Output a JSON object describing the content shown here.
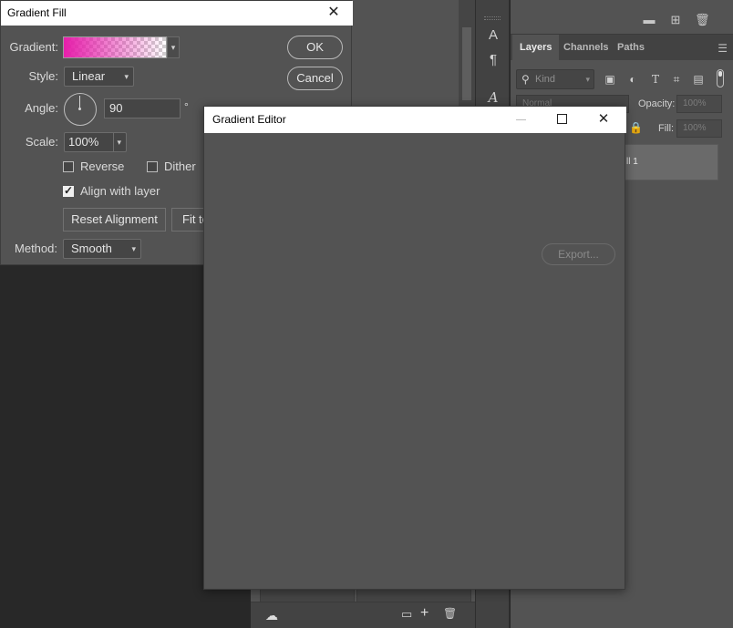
{
  "gradient_fill": {
    "title": "Gradient Fill",
    "labels": {
      "gradient": "Gradient:",
      "style": "Style:",
      "angle": "Angle:",
      "scale": "Scale:",
      "method": "Method:"
    },
    "style_value": "Linear",
    "angle_value": "90",
    "degree_symbol": "°",
    "scale_value": "100%",
    "method_value": "Smooth",
    "reverse_label": "Reverse",
    "reverse_checked": false,
    "dither_label": "Dither",
    "dither_checked": false,
    "align_label": "Align with layer",
    "align_checked": true,
    "reset_alignment_label": "Reset Alignment",
    "fit_label": "Fit to",
    "ok_label": "OK",
    "cancel_label": "Cancel",
    "gradient_color": "#e61eaa"
  },
  "gradient_editor": {
    "title": "Gradient Editor",
    "export_label": "Export..."
  },
  "layers_panel": {
    "tabs": [
      "Layers",
      "Channels",
      "Paths"
    ],
    "active_tab": "Layers",
    "kind_placeholder": "Kind",
    "blend_mode": "Normal",
    "opacity_label": "Opacity:",
    "opacity_value": "100%",
    "fill_label": "Fill:",
    "fill_value": "100%",
    "layer_name": "ll 1"
  },
  "tools": {
    "icons": [
      "char-style-icon",
      "paragraph-style-icon",
      "glyph-icon"
    ]
  }
}
